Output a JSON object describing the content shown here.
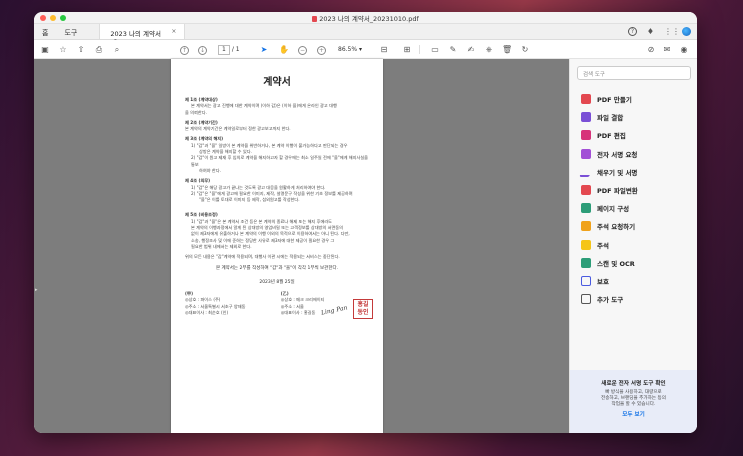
{
  "window": {
    "title": "2023 나의 계약서_20231010.pdf"
  },
  "tabs": {
    "home": "홈",
    "tools": "도구",
    "doc": "2023 나의 계약서_2...",
    "close": "×"
  },
  "toolbar": {
    "page_current": "1",
    "page_total": "/ 1",
    "zoom": "86.5%"
  },
  "doc": {
    "title": "계약서",
    "articles": [
      {
        "h": "제 1조 (계약대상)",
        "lines": [
          "본 계약서는 광고 진행에 대한 계약이며 (이하 갑)은 (이하 을)에게 온라인 광고 대행",
          "을 의뢰한다."
        ]
      },
      {
        "h": "제 2조 (계약기간)",
        "lines": [
          "본 계약의 계약기간은 계약일로부터 정한 광고보고까지 한다."
        ]
      },
      {
        "h": "제 3조 (계약의 해지)",
        "lines": [
          "1) \"갑\"과 \"을\" 일방이 본 계약을 위반하거나, 본 계약 이행이 불가능하다고 판단되는 경우",
          "상방은 계약을 해지할 수 있다.",
          "2) \"갑\"이 원고 제재 후 임의로 계약을 해지하고자 할 경우에는 최소 일주일 전에 \"을\"에게 해지사실을 통보",
          "하여야 한다."
        ]
      },
      {
        "h": "제 4조 (의무)",
        "lines": [
          "1) \"갑\"은 해당 광고가 끝나는 것도록 광고 대응을 원활하게 처리하여야 한다.",
          "2) \"갑\"은 \"을\"에게 광고에 필요한 이미지, 제작, 설명문구 작성을 위한 기초 정보를 제공하며",
          "\"을\"은 이를 토대로 이미지 등 제작, 섭외원고를 작성한다."
        ]
      },
      {
        "h": "제 5조 (비용조정)",
        "lines": [
          "1) \"갑\"과 \"을\"은 본 계약서 조건 등은 본 계약의 종료나 해제 또는 해지 후에라도",
          "본 계약의 이행과정에서 알게 된 상대방의 영업비밀 또는 고객정보를 상대방의 서면동의",
          "없이 제3자에게 유출하거나 본 계약의 이행 이외의 목적으로 이용하여서는 아니 된다. 다만,",
          "소송, 행정조사 및 이에 준하는 정당한 사유로 제3자에 대한 제공이 필요한 경우 그",
          "필요한 범위 내에서는 제외로 한다."
        ]
      }
    ],
    "closing": "위의 모든 내용은 \"갑\"계약에 적용되며, 대행사 이관 시에는 적용되는 서비스는 중단된다.",
    "center_line": "본 계약서는 2부를 작성하여 \"갑\"과 \"을\"이 각각 1부씩 보관한다.",
    "date": "2023년 8월 25일",
    "party_a": {
      "h": "(甲)",
      "l1": "◎상호 : 파이스 (주)",
      "l2": "◎주소 : 서울특별시 서초구 양재동",
      "l3": "◎대표이사 : 최순호 (인)"
    },
    "party_b": {
      "h": "(乙)",
      "l1": "◎상호 : 메크 크리에이티",
      "l2": "◎주소 : 서울",
      "l3": "◎대표이사 : 홍길동"
    },
    "signature": "Ling Pan",
    "seal": [
      "홍길",
      "동인"
    ]
  },
  "sidebar": {
    "search_placeholder": "검색 도구",
    "tools": [
      {
        "label": "PDF 만들기",
        "icon": "create-pdf-icon",
        "color": "#e34850"
      },
      {
        "label": "파일 결합",
        "icon": "combine-files-icon",
        "color": "#7a4fd6"
      },
      {
        "label": "PDF 편집",
        "icon": "edit-pdf-icon",
        "color": "#d7337a"
      },
      {
        "label": "전자 서명 요청",
        "icon": "request-esign-icon",
        "color": "#a24fd6"
      },
      {
        "label": "채우기 및 서명",
        "icon": "fill-sign-icon",
        "color": "#7a4fd6"
      },
      {
        "label": "PDF 파일변환",
        "icon": "export-pdf-icon",
        "color": "#e34850"
      },
      {
        "label": "페이지 구성",
        "icon": "organize-pages-icon",
        "color": "#2d9d78"
      },
      {
        "label": "주석 요청하기",
        "icon": "request-comments-icon",
        "color": "#f0a21b"
      },
      {
        "label": "주석",
        "icon": "comment-icon",
        "color": "#f5c518"
      },
      {
        "label": "스캔 및 OCR",
        "icon": "scan-ocr-icon",
        "color": "#2d9d78"
      },
      {
        "label": "보호",
        "icon": "protect-icon",
        "color": "#4a5ae0"
      },
      {
        "label": "추가 도구",
        "icon": "more-tools-icon",
        "color": "#555555"
      }
    ],
    "promo": {
      "title": "새로운 전자 서명 도구 확인",
      "body1": "빠 방식을 사용하고, 대량으로",
      "body2": "전송하고, 브랜딩을 추가하는 등의",
      "body3": "작업을 할 수 있습니다.",
      "link": "모두 보기"
    }
  }
}
